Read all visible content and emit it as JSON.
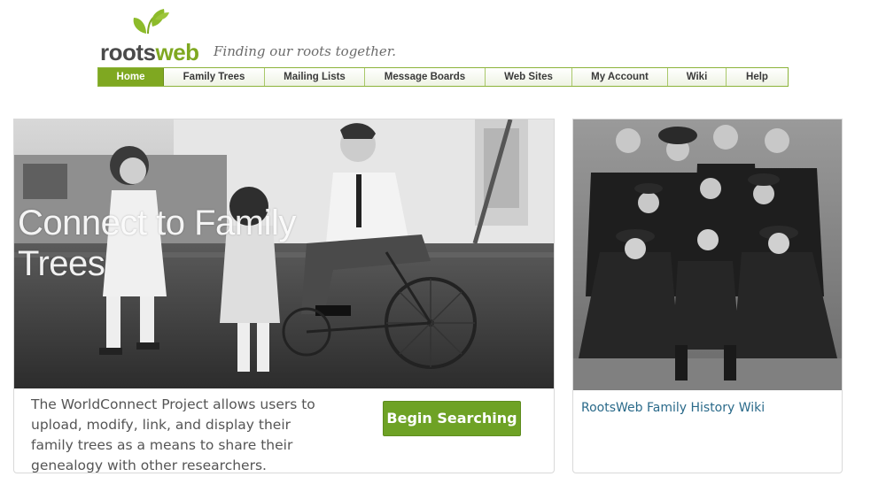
{
  "brand": {
    "logo_roots": "roots",
    "logo_web": "web",
    "tagline": "Finding our roots together.",
    "colors": {
      "green": "#7fa821",
      "button_green": "#6ea225",
      "link_blue": "#2a6a8a"
    }
  },
  "nav": {
    "items": [
      {
        "label": "Home",
        "active": true
      },
      {
        "label": "Family Trees"
      },
      {
        "label": "Mailing Lists"
      },
      {
        "label": "Message Boards"
      },
      {
        "label": "Web Sites"
      },
      {
        "label": "My Account"
      },
      {
        "label": "Wiki"
      },
      {
        "label": "Help"
      }
    ]
  },
  "main_card": {
    "hero_title": "Connect to Family Trees",
    "description": "The WorldConnect Project allows users to upload, modify, link, and display their family trees as a means to share their genealogy with other researchers.",
    "button_label": "Begin Searching"
  },
  "side_card": {
    "link_label": "RootsWeb Family History Wiki"
  }
}
